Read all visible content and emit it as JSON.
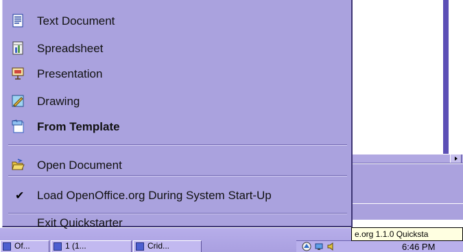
{
  "menu": {
    "items": [
      {
        "label": "Text Document",
        "icon": "text-document-icon"
      },
      {
        "label": "Spreadsheet",
        "icon": "spreadsheet-icon"
      },
      {
        "label": "Presentation",
        "icon": "presentation-icon"
      },
      {
        "label": "Drawing",
        "icon": "drawing-icon"
      },
      {
        "label": "From Template",
        "icon": "template-icon"
      },
      {
        "label": "Open Document",
        "icon": "open-folder-icon"
      },
      {
        "label": "Load OpenOffice.org During System Start-Up",
        "checked": true
      },
      {
        "label": "Exit Quickstarter"
      }
    ]
  },
  "tooltip": {
    "text": "e.org 1.1.0 Quicksta"
  },
  "taskbar": {
    "buttons": [
      "Of...",
      "1 (1...",
      "Crid..."
    ],
    "clock": "6:46 PM"
  },
  "colors": {
    "menu_bg": "#aaa2de",
    "taskbar_bg": "#b0a6e6",
    "accent_dark": "#5c4fb6"
  }
}
